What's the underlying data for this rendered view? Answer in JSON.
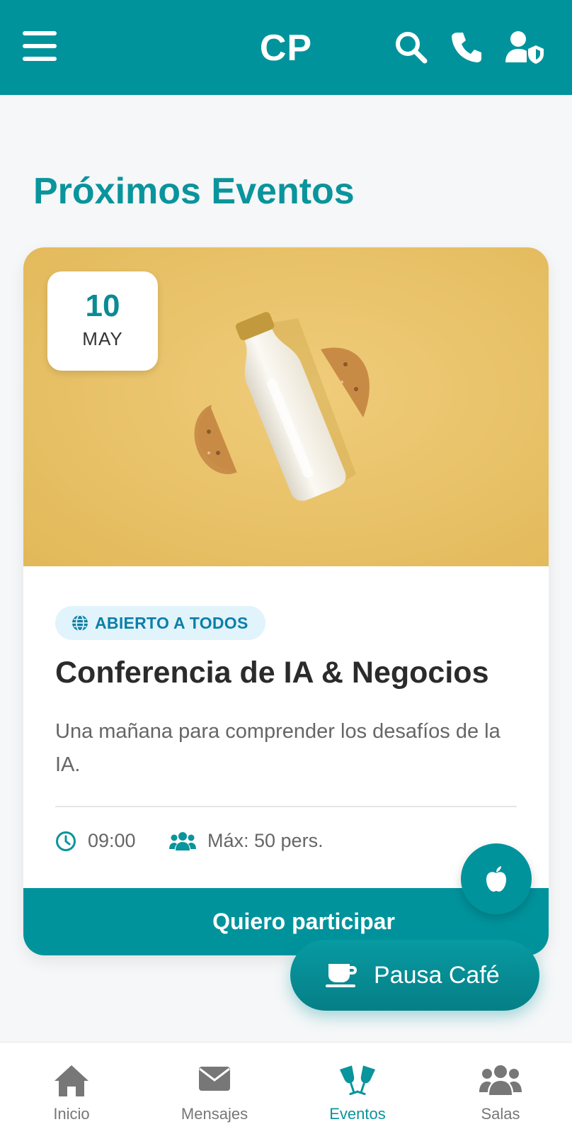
{
  "header": {
    "brand": "CP",
    "icons": [
      "menu-icon",
      "search-icon",
      "phone-icon",
      "user-shield-icon"
    ],
    "background": "#00939c"
  },
  "page": {
    "title": "Próximos Eventos"
  },
  "event": {
    "date_day": "10",
    "date_month": "MAY",
    "tag": "ABIERTO A TODOS",
    "title": "Conferencia de IA & Negocios",
    "description": "Una mañana para comprender los desafíos de la IA.",
    "time": "09:00",
    "capacity": "Máx: 50 pers.",
    "cta_label": "Quiero participar"
  },
  "fabs": {
    "coffee_label": "Pausa Café"
  },
  "bottom_nav": {
    "items": [
      {
        "label": "Inicio",
        "icon": "home-icon",
        "active": false
      },
      {
        "label": "Mensajes",
        "icon": "envelope-icon",
        "active": false
      },
      {
        "label": "Eventos",
        "icon": "glasses-cheers-icon",
        "active": true
      },
      {
        "label": "Salas",
        "icon": "users-icon",
        "active": false
      }
    ]
  },
  "colors": {
    "accent": "#00939c",
    "title": "#0a949c",
    "tag_bg": "#e1f3fb",
    "tag_text": "#0b7fa8",
    "image_bg": "#e7c163"
  }
}
